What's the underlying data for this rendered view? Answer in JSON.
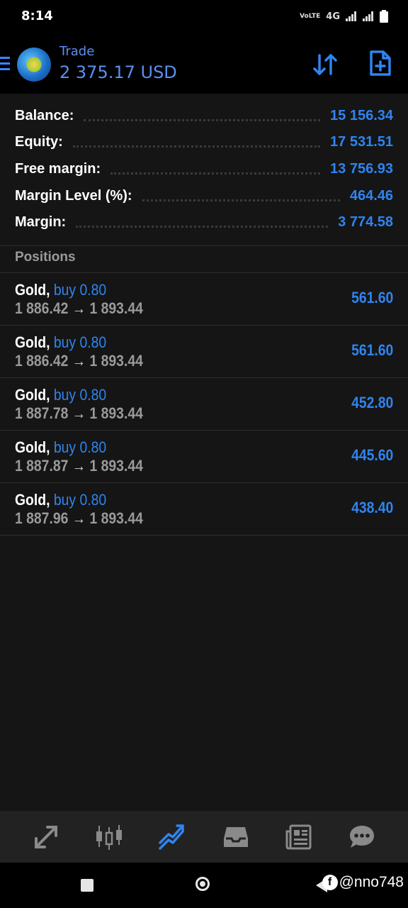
{
  "status_bar": {
    "time": "8:14",
    "network": "4G"
  },
  "header": {
    "title": "Trade",
    "balance": "2 375.17 USD"
  },
  "summary": [
    {
      "label": "Balance:",
      "value": "15 156.34"
    },
    {
      "label": "Equity:",
      "value": "17 531.51"
    },
    {
      "label": "Free margin:",
      "value": "13 756.93"
    },
    {
      "label": "Margin Level (%):",
      "value": "464.46"
    },
    {
      "label": "Margin:",
      "value": "3 774.58"
    }
  ],
  "positions_title": "Positions",
  "positions": [
    {
      "symbol": "Gold,",
      "side": "buy 0.80",
      "open": "1 886.42",
      "arrow": "→",
      "current": "1 893.44",
      "profit": "561.60"
    },
    {
      "symbol": "Gold,",
      "side": "buy 0.80",
      "open": "1 886.42",
      "arrow": "→",
      "current": "1 893.44",
      "profit": "561.60"
    },
    {
      "symbol": "Gold,",
      "side": "buy 0.80",
      "open": "1 887.78",
      "arrow": "→",
      "current": "1 893.44",
      "profit": "452.80"
    },
    {
      "symbol": "Gold,",
      "side": "buy 0.80",
      "open": "1 887.87",
      "arrow": "→",
      "current": "1 893.44",
      "profit": "445.60"
    },
    {
      "symbol": "Gold,",
      "side": "buy 0.80",
      "open": "1 887.96",
      "arrow": "→",
      "current": "1 893.44",
      "profit": "438.40"
    }
  ],
  "bottom_nav": [
    {
      "icon": "quotes-icon",
      "active": false
    },
    {
      "icon": "chart-candles-icon",
      "active": false
    },
    {
      "icon": "trade-icon",
      "active": true
    },
    {
      "icon": "history-inbox-icon",
      "active": false
    },
    {
      "icon": "news-icon",
      "active": false
    },
    {
      "icon": "chat-icon",
      "active": false
    }
  ],
  "watermark": {
    "handle": "@nno748"
  },
  "colors": {
    "accent": "#2f84f0",
    "header_text": "#5b8ff0",
    "background": "#151515",
    "muted": "#9a9a9a"
  }
}
